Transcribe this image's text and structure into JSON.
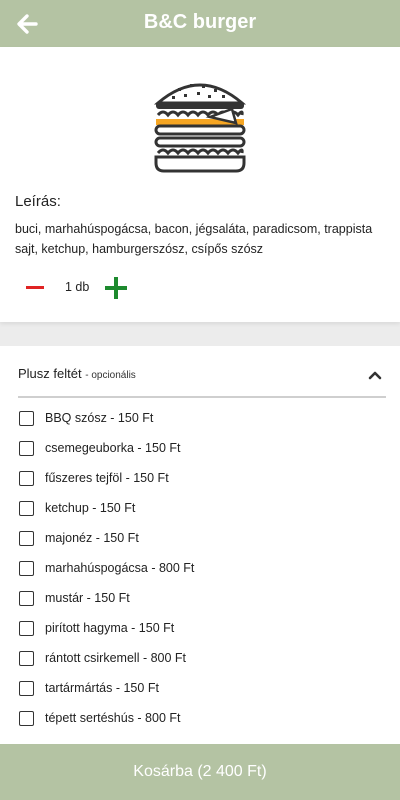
{
  "header": {
    "title": "B&C burger",
    "back_icon": "arrow-left-icon"
  },
  "product": {
    "image_icon": "burger-icon",
    "description_label": "Leírás:",
    "description": "buci, marhahúspogácsa, bacon, jégsaláta, paradicsom, trappista sajt, ketchup, hamburgerszósz, csípős szósz",
    "quantity": "1 db"
  },
  "extras": {
    "title": "Plusz feltét",
    "subtitle": "- opcionális",
    "options": [
      "BBQ szósz - 150 Ft",
      "csemegeuborka - 150 Ft",
      "fűszeres tejföl - 150 Ft",
      "ketchup - 150 Ft",
      "majonéz - 150 Ft",
      "marhahúspogácsa - 800 Ft",
      "mustár - 150 Ft",
      "pirított hagyma - 150 Ft",
      "rántott csirkemell - 800 Ft",
      "tartármártás - 150 Ft",
      "tépett sertéshús - 800 Ft"
    ]
  },
  "cart": {
    "label": "Kosárba (2 400 Ft)"
  },
  "colors": {
    "bar": "#b4c3a3",
    "minus": "#e02323",
    "plus": "#1d8a2e",
    "cheese": "#f6a623"
  }
}
